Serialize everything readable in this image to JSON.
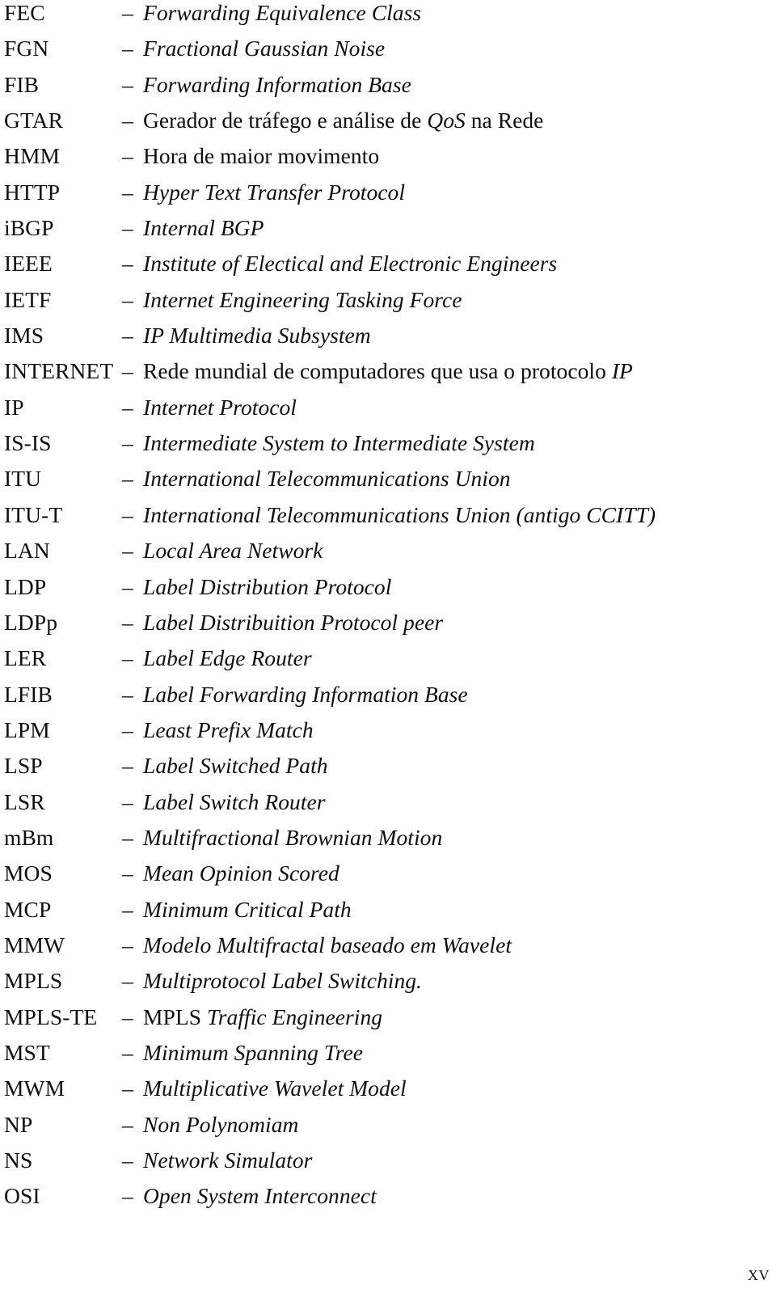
{
  "page": {
    "kind": "abbreviations-and-acronyms-list",
    "page_number": "xv",
    "separator": "–"
  },
  "entries": [
    {
      "term": "FEC",
      "definition": "Forwarding Equivalence Class",
      "style": "italic"
    },
    {
      "term": "FGN",
      "definition": "Fractional Gaussian Noise",
      "style": "italic"
    },
    {
      "term": "FIB",
      "definition": "Forwarding Information Base",
      "style": "italic"
    },
    {
      "term": "GTAR",
      "definition": "Gerador de tráfego e análise de QoS na Rede",
      "style": "roman",
      "emphasis": "QoS"
    },
    {
      "term": "HMM",
      "definition": "Hora de maior movimento",
      "style": "roman"
    },
    {
      "term": "HTTP",
      "definition": "Hyper Text Transfer Protocol",
      "style": "italic"
    },
    {
      "term": "iBGP",
      "definition": "Internal BGP",
      "style": "italic"
    },
    {
      "term": "IEEE",
      "definition": "Institute of Electical and Electronic Engineers",
      "style": "italic"
    },
    {
      "term": "IETF",
      "definition": "Internet Engineering Tasking Force",
      "style": "italic"
    },
    {
      "term": "IMS",
      "definition": "IP Multimedia Subsystem",
      "style": "italic"
    },
    {
      "term": "INTERNET",
      "definition": "Rede mundial de computadores que usa o protocolo IP",
      "style": "roman",
      "emphasis": "IP"
    },
    {
      "term": "IP",
      "definition": "Internet Protocol",
      "style": "italic"
    },
    {
      "term": "IS-IS",
      "definition": "Intermediate System to Intermediate System",
      "style": "italic"
    },
    {
      "term": "ITU",
      "definition": "International Telecommunications Union",
      "style": "italic"
    },
    {
      "term": "ITU-T",
      "definition": "International Telecommunications Union (antigo CCITT)",
      "style": "italic"
    },
    {
      "term": "LAN",
      "definition": "Local Area Network",
      "style": "italic"
    },
    {
      "term": "LDP",
      "definition": "Label Distribution Protocol",
      "style": "italic"
    },
    {
      "term": "LDPp",
      "definition": "Label Distribuition Protocol peer",
      "style": "italic"
    },
    {
      "term": "LER",
      "definition": "Label Edge Router",
      "style": "italic"
    },
    {
      "term": "LFIB",
      "definition": "Label Forwarding Information Base",
      "style": "italic"
    },
    {
      "term": "LPM",
      "definition": "Least Prefix Match",
      "style": "italic"
    },
    {
      "term": "LSP",
      "definition": "Label Switched Path",
      "style": "italic"
    },
    {
      "term": "LSR",
      "definition": "Label Switch Router",
      "style": "italic"
    },
    {
      "term": "mBm",
      "definition": "Multifractional Brownian Motion",
      "style": "italic"
    },
    {
      "term": "MOS",
      "definition": "Mean Opinion Scored",
      "style": "italic"
    },
    {
      "term": "MCP",
      "definition": "Minimum Critical Path",
      "style": "italic"
    },
    {
      "term": "MMW",
      "definition": "Modelo Multifractal baseado em Wavelet",
      "style": "italic"
    },
    {
      "term": "MPLS",
      "definition": "Multiprotocol Label Switching.",
      "style": "italic"
    },
    {
      "term": "MPLS-TE",
      "definition": "MPLS Traffic Engineering",
      "style": "italic",
      "leading_upright": "MPLS"
    },
    {
      "term": "MST",
      "definition": "Minimum Spanning Tree",
      "style": "italic"
    },
    {
      "term": "MWM",
      "definition": "Multiplicative Wavelet Model",
      "style": "italic"
    },
    {
      "term": "NP",
      "definition": "Non Polynomiam",
      "style": "italic"
    },
    {
      "term": "NS",
      "definition": "Network Simulator",
      "style": "italic"
    },
    {
      "term": "OSI",
      "definition": "Open System Interconnect",
      "style": "italic"
    }
  ]
}
